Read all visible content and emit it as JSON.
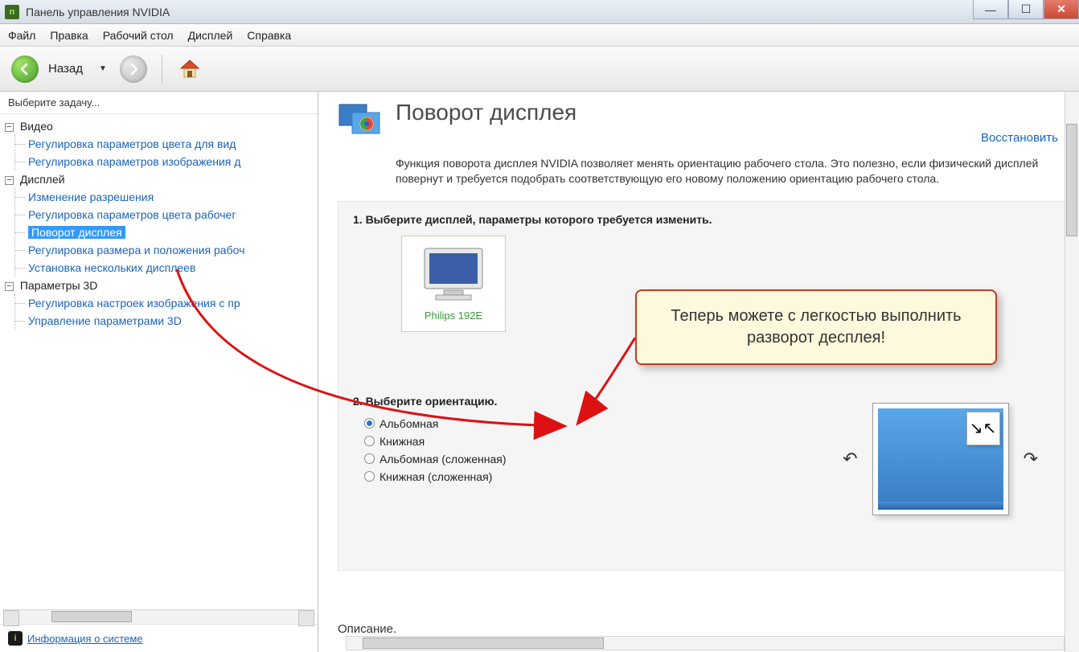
{
  "titlebar": {
    "title": "Панель управления NVIDIA"
  },
  "menubar": [
    "Файл",
    "Правка",
    "Рабочий стол",
    "Дисплей",
    "Справка"
  ],
  "toolbar": {
    "back_label": "Назад"
  },
  "sidebar": {
    "header": "Выберите задачу...",
    "nodes": [
      {
        "label": "Видео",
        "items": [
          "Регулировка параметров цвета для вид",
          "Регулировка параметров изображения д"
        ]
      },
      {
        "label": "Дисплей",
        "items": [
          "Изменение разрешения",
          "Регулировка параметров цвета рабочег",
          "Поворот дисплея",
          "Регулировка размера и положения рабоч",
          "Установка нескольких дисплеев"
        ]
      },
      {
        "label": "Параметры 3D",
        "items": [
          "Регулировка настроек изображения с пр",
          "Управление параметрами 3D"
        ]
      }
    ],
    "footer_link": "Информация о системе"
  },
  "content": {
    "title": "Поворот дисплея",
    "restore": "Восстановить",
    "description": "Функция поворота дисплея NVIDIA позволяет менять ориентацию рабочего стола. Это полезно, если физический дисплей повернут и требуется подобрать соответствующую его новому положению ориентацию рабочего стола.",
    "step1_title": "1. Выберите дисплей, параметры которого требуется изменить.",
    "monitor_label": "Philips 192E",
    "step2_title": "2. Выберите ориентацию.",
    "orientations": [
      "Альбомная",
      "Книжная",
      "Альбомная (сложенная)",
      "Книжная (сложенная)"
    ],
    "selected_orientation": 0,
    "description_label": "Описание."
  },
  "callout": {
    "text": "Теперь можете с легкостью выполнить разворот десплея!"
  }
}
